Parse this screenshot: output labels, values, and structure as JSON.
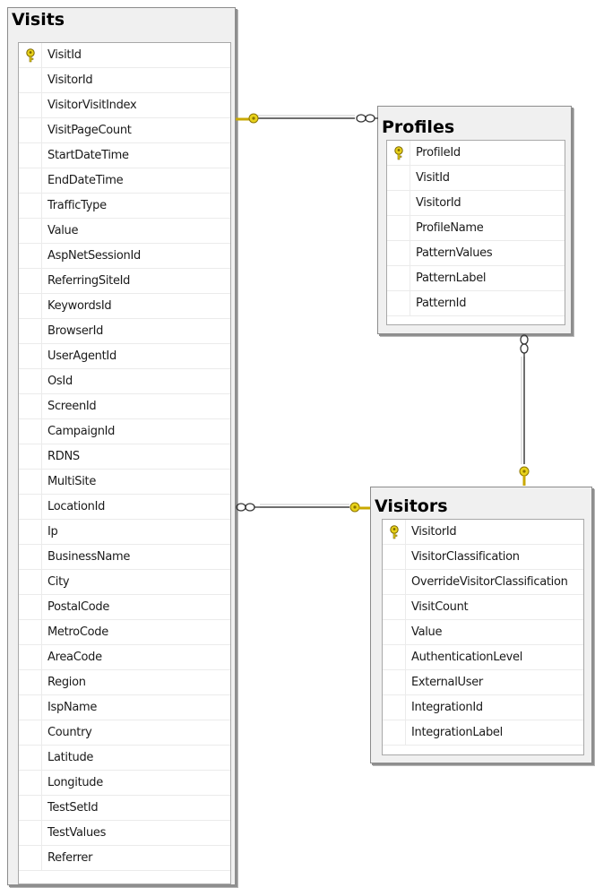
{
  "tables": {
    "visits": {
      "title": "Visits",
      "columns": [
        "VisitId",
        "VisitorId",
        "VisitorVisitIndex",
        "VisitPageCount",
        "StartDateTime",
        "EndDateTime",
        "TrafficType",
        "Value",
        "AspNetSessionId",
        "ReferringSiteId",
        "KeywordsId",
        "BrowserId",
        "UserAgentId",
        "OsId",
        "ScreenId",
        "CampaignId",
        "RDNS",
        "MultiSite",
        "LocationId",
        "Ip",
        "BusinessName",
        "City",
        "PostalCode",
        "MetroCode",
        "AreaCode",
        "Region",
        "IspName",
        "Country",
        "Latitude",
        "Longitude",
        "TestSetId",
        "TestValues",
        "Referrer"
      ],
      "primary_key": "VisitId"
    },
    "profiles": {
      "title": "Profiles",
      "columns": [
        "ProfileId",
        "VisitId",
        "VisitorId",
        "ProfileName",
        "PatternValues",
        "PatternLabel",
        "PatternId"
      ],
      "primary_key": "ProfileId"
    },
    "visitors": {
      "title": "Visitors",
      "columns": [
        "VisitorId",
        "VisitorClassification",
        "OverrideVisitorClassification",
        "VisitCount",
        "Value",
        "AuthenticationLevel",
        "ExternalUser",
        "IntegrationId",
        "IntegrationLabel"
      ],
      "primary_key": "VisitorId"
    }
  },
  "relationships": [
    {
      "from": "Visits",
      "to": "Profiles",
      "one_end": "Visits",
      "many_end": "Profiles"
    },
    {
      "from": "Visitors",
      "to": "Profiles",
      "one_end": "Visitors",
      "many_end": "Profiles"
    },
    {
      "from": "Visitors",
      "to": "Visits",
      "one_end": "Visitors",
      "many_end": "Visits"
    }
  ],
  "colors": {
    "key": "#e8d21a",
    "line": "#6e6e6e",
    "table_bg": "#f0f0f0",
    "table_border": "#8c8c8c"
  },
  "icons": {
    "primary_key": "key-icon",
    "one_end": "key-icon",
    "many_end": "infinity-icon"
  }
}
